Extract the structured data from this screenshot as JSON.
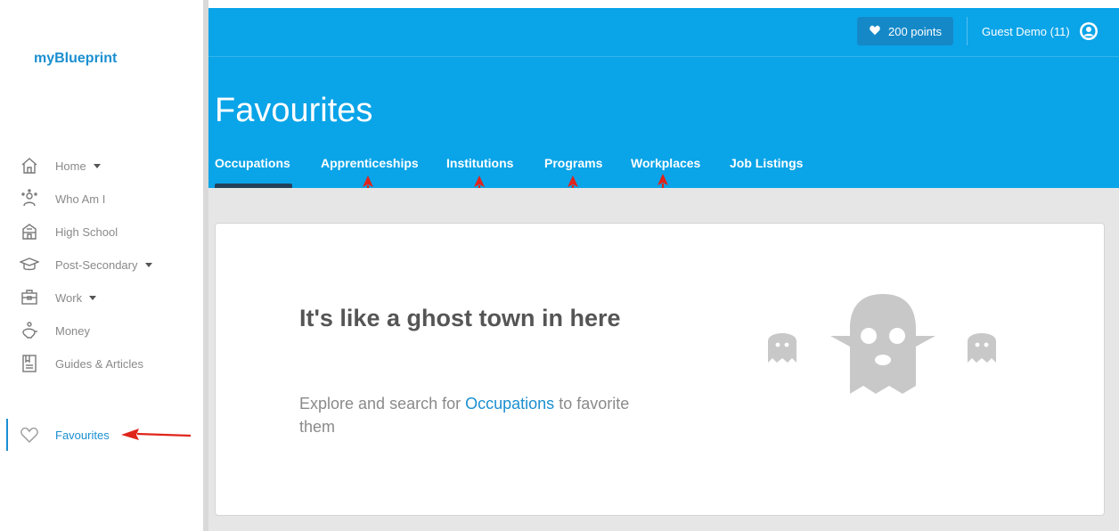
{
  "sidebar": {
    "brand": "myBlueprint",
    "items": [
      {
        "label": "Home",
        "icon": "home-icon"
      },
      {
        "label": "Who Am I",
        "icon": "person-icon"
      },
      {
        "label": "High School",
        "icon": "school-icon"
      },
      {
        "label": "Post-Secondary",
        "icon": "graduation-cap-icon"
      },
      {
        "label": "Work",
        "icon": "briefcase-icon"
      },
      {
        "label": "Money",
        "icon": "piggy-bank-icon"
      },
      {
        "label": "Guides & Articles",
        "icon": "book-icon"
      }
    ],
    "favourites": {
      "label": "Favourites",
      "icon": "heart-icon"
    }
  },
  "header": {
    "points": "200 points",
    "user": "Guest Demo (11)",
    "title": "Favourites",
    "tabs": [
      "Occupations",
      "Apprenticeships",
      "Institutions",
      "Programs",
      "Workplaces",
      "Job Listings"
    ],
    "active_tab": "Occupations"
  },
  "empty_state": {
    "title": "It's like a ghost town in here",
    "text_before": "Explore and search for",
    "link": "Occupations",
    "text_after": "to favorite them"
  },
  "colors": {
    "header": "#0aa4e8",
    "accent": "#1a8fd0",
    "arrow": "#e0241b",
    "ghost": "#c8c8c8"
  }
}
